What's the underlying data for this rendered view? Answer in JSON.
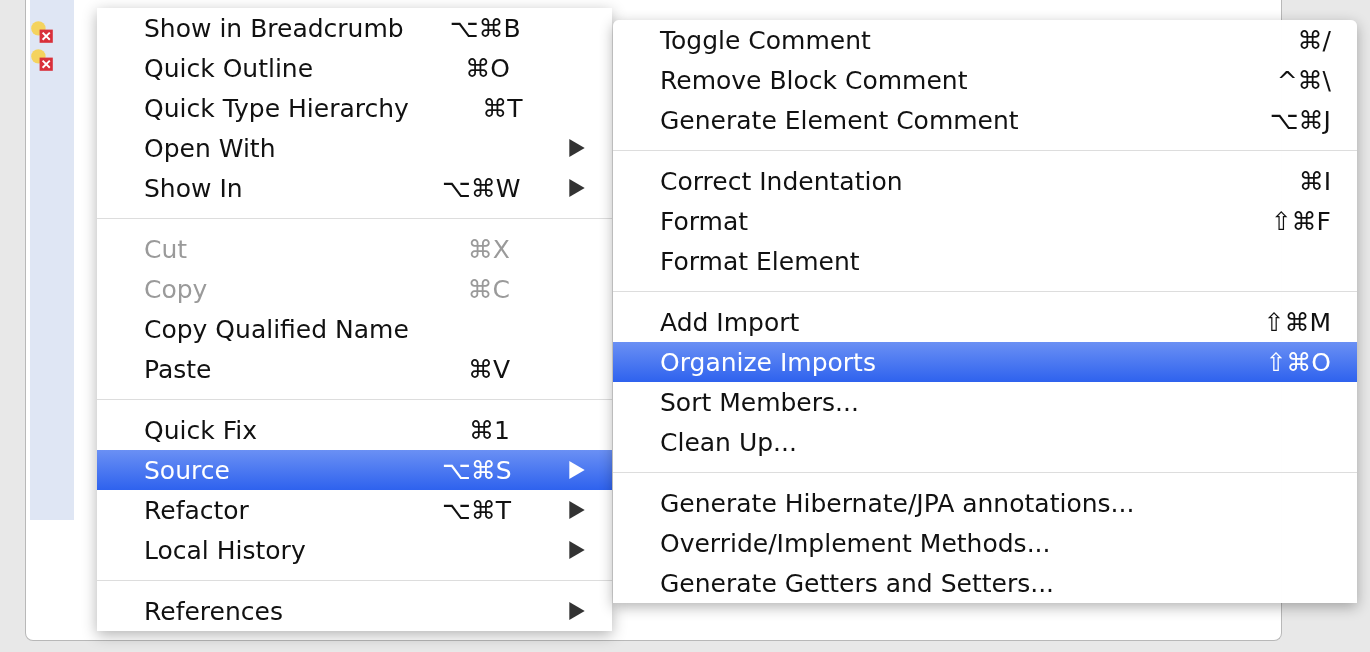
{
  "context_menu": {
    "groups": [
      [
        {
          "label": "Show in Breadcrumb",
          "shortcut": "⌥⌘B",
          "has_submenu": false,
          "disabled": false,
          "selected": false
        },
        {
          "label": "Quick Outline",
          "shortcut": "⌘O",
          "has_submenu": false,
          "disabled": false,
          "selected": false
        },
        {
          "label": "Quick Type Hierarchy",
          "shortcut": "⌘T",
          "has_submenu": false,
          "disabled": false,
          "selected": false
        },
        {
          "label": "Open With",
          "has_submenu": true,
          "disabled": false,
          "selected": false
        },
        {
          "label": "Show In",
          "shortcut": "⌥⌘W",
          "has_submenu": true,
          "disabled": false,
          "selected": false
        }
      ],
      [
        {
          "label": "Cut",
          "shortcut": "⌘X",
          "has_submenu": false,
          "disabled": true,
          "selected": false
        },
        {
          "label": "Copy",
          "shortcut": "⌘C",
          "has_submenu": false,
          "disabled": true,
          "selected": false
        },
        {
          "label": "Copy Qualified Name",
          "has_submenu": false,
          "disabled": false,
          "selected": false
        },
        {
          "label": "Paste",
          "shortcut": "⌘V",
          "has_submenu": false,
          "disabled": false,
          "selected": false
        }
      ],
      [
        {
          "label": "Quick Fix",
          "shortcut": "⌘1",
          "has_submenu": false,
          "disabled": false,
          "selected": false
        },
        {
          "label": "Source",
          "shortcut": "⌥⌘S",
          "has_submenu": true,
          "disabled": false,
          "selected": true
        },
        {
          "label": "Refactor",
          "shortcut": "⌥⌘T",
          "has_submenu": true,
          "disabled": false,
          "selected": false
        },
        {
          "label": "Local History",
          "has_submenu": true,
          "disabled": false,
          "selected": false
        }
      ],
      [
        {
          "label": "References",
          "has_submenu": true,
          "disabled": false,
          "selected": false
        }
      ]
    ]
  },
  "source_submenu": {
    "groups": [
      [
        {
          "label": "Toggle Comment",
          "shortcut": "⌘/",
          "selected": false
        },
        {
          "label": "Remove Block Comment",
          "shortcut": "^⌘\\",
          "selected": false
        },
        {
          "label": "Generate Element Comment",
          "shortcut": "⌥⌘J",
          "selected": false
        }
      ],
      [
        {
          "label": "Correct Indentation",
          "shortcut": "⌘I",
          "selected": false
        },
        {
          "label": "Format",
          "shortcut": "⇧⌘F",
          "selected": false
        },
        {
          "label": "Format Element",
          "selected": false
        }
      ],
      [
        {
          "label": "Add Import",
          "shortcut": "⇧⌘M",
          "selected": false
        },
        {
          "label": "Organize Imports",
          "shortcut": "⇧⌘O",
          "selected": true
        },
        {
          "label": "Sort Members...",
          "selected": false
        },
        {
          "label": "Clean Up...",
          "selected": false
        }
      ],
      [
        {
          "label": "Generate Hibernate/JPA annotations...",
          "selected": false
        },
        {
          "label": "Override/Implement Methods...",
          "selected": false
        },
        {
          "label": "Generate Getters and Setters...",
          "selected": false
        }
      ]
    ]
  }
}
